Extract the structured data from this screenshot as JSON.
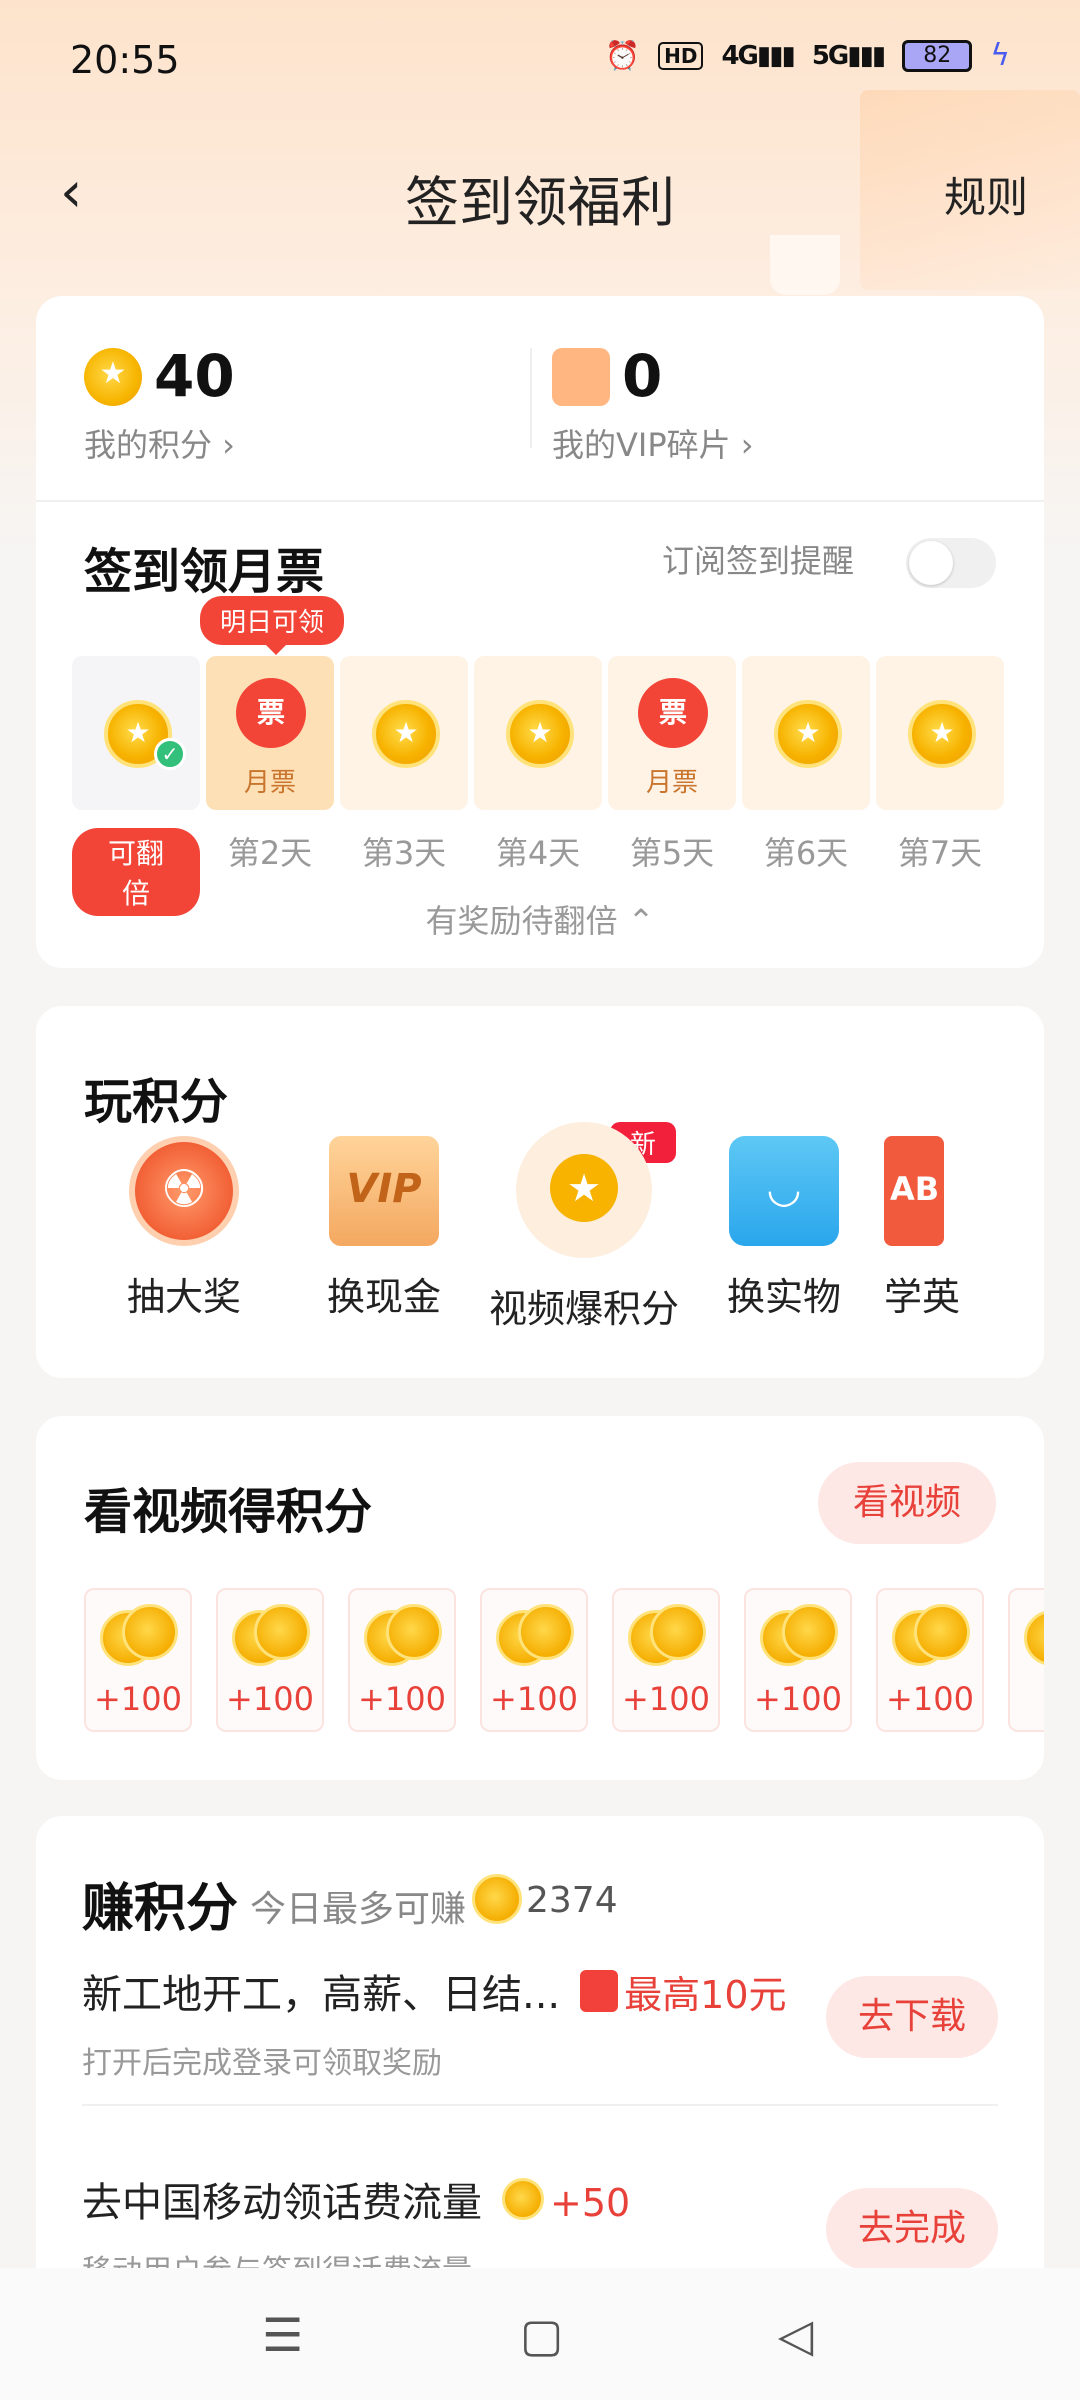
{
  "status_bar": {
    "time": "20:55",
    "hd": "HD",
    "net4g": "4G",
    "net5g": "5G",
    "battery": "82"
  },
  "header": {
    "back_icon": "chevron-left-icon",
    "title": "签到领福利",
    "rules": "规则"
  },
  "summary": {
    "points_value": "40",
    "points_label": "我的积分 ›",
    "vip_value": "0",
    "vip_label": "我的VIP碎片 ›"
  },
  "checkin": {
    "title": "签到领月票",
    "reminder_label": "订阅签到提醒",
    "reminder_on": false,
    "tomorrow_badge": "明日可领",
    "days": [
      {
        "label": "可翻倍",
        "reward": "coin",
        "state": "done"
      },
      {
        "label": "第2天",
        "reward": "ticket",
        "ticket_text": "月票",
        "state": "highlight"
      },
      {
        "label": "第3天",
        "reward": "coin"
      },
      {
        "label": "第4天",
        "reward": "coin"
      },
      {
        "label": "第5天",
        "reward": "ticket",
        "ticket_text": "月票"
      },
      {
        "label": "第6天",
        "reward": "coin"
      },
      {
        "label": "第7天",
        "reward": "coin"
      }
    ],
    "ticket_glyph": "票",
    "more_text": "有奖励待翻倍 ⌃"
  },
  "play": {
    "title": "玩积分",
    "new_badge": "新",
    "items": [
      {
        "label": "抽大奖",
        "icon": "lucky-draw-icon"
      },
      {
        "label": "换现金",
        "icon": "vip-card-icon"
      },
      {
        "label": "视频爆积分",
        "icon": "video-coin-icon"
      },
      {
        "label": "换实物",
        "icon": "shopping-bag-icon"
      },
      {
        "label": "学英",
        "icon": "english-book-icon"
      }
    ]
  },
  "video": {
    "title": "看视频得积分",
    "button": "看视频",
    "rewards": [
      "+100",
      "+100",
      "+100",
      "+100",
      "+100",
      "+100",
      "+100",
      "+"
    ]
  },
  "earn": {
    "title": "赚积分",
    "subtitle": "今日最多可赚",
    "max_points": "2374",
    "tasks": [
      {
        "title": "新工地开工，高薪、日结...",
        "reward": "最高10元",
        "desc": "打开后完成登录可领取奖励",
        "button": "去下载"
      },
      {
        "title": "去中国移动领话费流量",
        "reward": "+50",
        "desc": "移动用户参与签到得话费流量",
        "button": "去完成"
      }
    ]
  },
  "navbar": {
    "menu": "☰",
    "home": "▢",
    "back": "◁"
  },
  "colors": {
    "accent_red": "#f24538",
    "coin_gold": "#f7b300",
    "hero_bg": "#fde3cc"
  }
}
